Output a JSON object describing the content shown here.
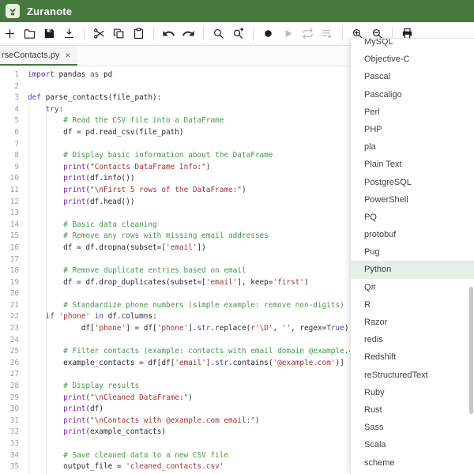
{
  "app": {
    "title": "Zuranote"
  },
  "colors": {
    "accent": "#47793f",
    "keyword": "#5537be",
    "builtin": "#7d2da5",
    "type": "#2d50c8",
    "string": "#a5322d",
    "comment": "#429a46",
    "text": "#24292f",
    "line_number": "#9aa0a6",
    "menu_highlight": "#e9ede8"
  },
  "toolbar": {
    "groups": [
      {
        "buttons": [
          {
            "icon": "new-file"
          },
          {
            "icon": "open-folder"
          },
          {
            "icon": "save"
          },
          {
            "icon": "download"
          }
        ]
      },
      {
        "buttons": [
          {
            "icon": "cut"
          },
          {
            "icon": "copy"
          },
          {
            "icon": "paste"
          }
        ]
      },
      {
        "buttons": [
          {
            "icon": "undo"
          },
          {
            "icon": "redo"
          }
        ]
      },
      {
        "buttons": [
          {
            "icon": "find"
          },
          {
            "icon": "find-replace"
          }
        ]
      },
      {
        "buttons": [
          {
            "icon": "record"
          },
          {
            "icon": "run",
            "disabled": true
          },
          {
            "icon": "loop",
            "disabled": true
          },
          {
            "icon": "run-all",
            "disabled": true
          }
        ]
      },
      {
        "buttons": [
          {
            "icon": "zoom-in"
          },
          {
            "icon": "zoom-out"
          }
        ]
      },
      {
        "buttons": [
          {
            "icon": "print"
          }
        ]
      }
    ]
  },
  "tab": {
    "label": "rseContacts.py",
    "close_glyph": "×",
    "active": true
  },
  "language_menu": {
    "selected": "Python",
    "items": [
      "MySQL",
      "Objective-C",
      "Pascal",
      "Pascaligo",
      "Perl",
      "PHP",
      "pla",
      "Plain Text",
      "PostgreSQL",
      "PowerShell",
      "PQ",
      "protobuf",
      "Pug",
      "Python",
      "Q#",
      "R",
      "Razor",
      "redis",
      "Redshift",
      "reStructuredText",
      "Ruby",
      "Rust",
      "Sass",
      "Scala",
      "scheme"
    ]
  },
  "editor": {
    "lines": [
      [
        [
          "kw",
          "import"
        ],
        [
          "pl",
          " pandas "
        ],
        [
          "kw",
          "as"
        ],
        [
          "pl",
          " pd"
        ]
      ],
      [],
      [
        [
          "kw",
          "def"
        ],
        [
          "pl",
          " parse_contacts(file_path):"
        ]
      ],
      [
        [
          "pl",
          "    "
        ],
        [
          "kw",
          "try"
        ],
        [
          "pl",
          ":"
        ]
      ],
      [
        [
          "pl",
          "        "
        ],
        [
          "co",
          "# Read the CSV file into a DataFrame"
        ]
      ],
      [
        [
          "pl",
          "        df = pd.read_csv(file_path)"
        ]
      ],
      [],
      [
        [
          "pl",
          "        "
        ],
        [
          "co",
          "# Display basic information about the DataFrame"
        ]
      ],
      [
        [
          "pl",
          "        "
        ],
        [
          "bi",
          "print"
        ],
        [
          "pl",
          "("
        ],
        [
          "st",
          "\"Contacts DataFrame Info:\""
        ],
        [
          "pl",
          ")"
        ]
      ],
      [
        [
          "pl",
          "        "
        ],
        [
          "bi",
          "print"
        ],
        [
          "pl",
          "(df.info())"
        ]
      ],
      [
        [
          "pl",
          "        "
        ],
        [
          "bi",
          "print"
        ],
        [
          "pl",
          "("
        ],
        [
          "st",
          "\"\\nFirst 5 rows of the DataFrame:\""
        ],
        [
          "pl",
          ")"
        ]
      ],
      [
        [
          "pl",
          "        "
        ],
        [
          "bi",
          "print"
        ],
        [
          "pl",
          "(df.head())"
        ]
      ],
      [],
      [
        [
          "pl",
          "        "
        ],
        [
          "co",
          "# Basic data cleaning"
        ]
      ],
      [
        [
          "pl",
          "        "
        ],
        [
          "co",
          "# Remove any rows with missing email addresses"
        ]
      ],
      [
        [
          "pl",
          "        df = df.dropna(subset=["
        ],
        [
          "st",
          "'email'"
        ],
        [
          "pl",
          "])"
        ]
      ],
      [],
      [
        [
          "pl",
          "        "
        ],
        [
          "co",
          "# Remove duplicate entries based on email"
        ]
      ],
      [
        [
          "pl",
          "        df = df.drop_duplicates(subset=["
        ],
        [
          "st",
          "'email'"
        ],
        [
          "pl",
          "], keep="
        ],
        [
          "st",
          "'first'"
        ],
        [
          "pl",
          ")"
        ]
      ],
      [],
      [
        [
          "pl",
          "        "
        ],
        [
          "co",
          "# Standardize phone numbers (simple example: remove non-digits)"
        ]
      ],
      [
        [
          "pl",
          "    "
        ],
        [
          "kw",
          "if"
        ],
        [
          "pl",
          " "
        ],
        [
          "st",
          "'phone'"
        ],
        [
          "pl",
          " "
        ],
        [
          "kw",
          "in"
        ],
        [
          "pl",
          " df.columns:"
        ]
      ],
      [
        [
          "pl",
          "            df["
        ],
        [
          "st",
          "'phone'"
        ],
        [
          "pl",
          "] = df["
        ],
        [
          "st",
          "'phone'"
        ],
        [
          "pl",
          "]."
        ],
        [
          "ty",
          "str"
        ],
        [
          "pl",
          ".replace("
        ],
        [
          "st",
          "r'\\D'"
        ],
        [
          "pl",
          ", "
        ],
        [
          "st",
          "''"
        ],
        [
          "pl",
          ", regex="
        ],
        [
          "kw",
          "True"
        ],
        [
          "pl",
          ")"
        ]
      ],
      [],
      [
        [
          "pl",
          "        "
        ],
        [
          "co",
          "# Filter contacts (example: contacts with email domain @example.com)"
        ]
      ],
      [
        [
          "pl",
          "        example_contacts = df[df["
        ],
        [
          "st",
          "'email'"
        ],
        [
          "pl",
          "]."
        ],
        [
          "ty",
          "str"
        ],
        [
          "pl",
          ".contains("
        ],
        [
          "st",
          "'@example.com'"
        ],
        [
          "pl",
          ")]"
        ]
      ],
      [],
      [
        [
          "pl",
          "        "
        ],
        [
          "co",
          "# Display results"
        ]
      ],
      [
        [
          "pl",
          "        "
        ],
        [
          "bi",
          "print"
        ],
        [
          "pl",
          "("
        ],
        [
          "st",
          "\"\\nCleaned DataFrame:\""
        ],
        [
          "pl",
          ")"
        ]
      ],
      [
        [
          "pl",
          "        "
        ],
        [
          "bi",
          "print"
        ],
        [
          "pl",
          "(df)"
        ]
      ],
      [
        [
          "pl",
          "        "
        ],
        [
          "bi",
          "print"
        ],
        [
          "pl",
          "("
        ],
        [
          "st",
          "\"\\nContacts with @example.com email:\""
        ],
        [
          "pl",
          ")"
        ]
      ],
      [
        [
          "pl",
          "        "
        ],
        [
          "bi",
          "print"
        ],
        [
          "pl",
          "(example_contacts)"
        ]
      ],
      [],
      [
        [
          "pl",
          "        "
        ],
        [
          "co",
          "# Save cleaned data to a new CSV file"
        ]
      ],
      [
        [
          "pl",
          "        output_file = "
        ],
        [
          "st",
          "'cleaned_contacts.csv'"
        ]
      ]
    ]
  }
}
